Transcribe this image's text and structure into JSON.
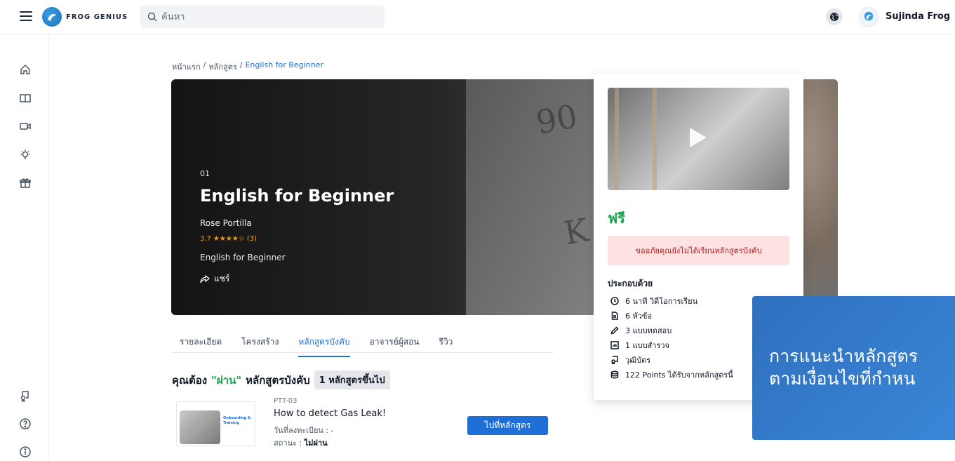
{
  "header": {
    "brand": "FROG GENIUS",
    "search_placeholder": "ค้นหา",
    "username": "Sujinda Frog"
  },
  "breadcrumb": {
    "home": "หน้าแรก",
    "sep1": "/",
    "courses": "หลักสูตร",
    "sep2": "/",
    "current": "English for Beginner"
  },
  "hero": {
    "number": "01",
    "title": "English for Beginner",
    "instructor": "Rose Portilla",
    "rating": "3.7",
    "stars": "★★★★☆",
    "rating_count": "(3)",
    "subtitle": "English for Beginner",
    "share_label": "แชร์"
  },
  "tabs": [
    {
      "label": "รายละเอียด"
    },
    {
      "label": "โครงสร้าง"
    },
    {
      "label": "หลักสูตรบังคับ"
    },
    {
      "label": "อาจารย์ผู้สอน"
    },
    {
      "label": "รีวิว"
    }
  ],
  "requirement": {
    "prefix": "คุณต้อง",
    "pass_word": "\"ผ่าน\"",
    "suffix": "หลักสูตรบังคับ",
    "badge": "1 หลักสูตรขึ้นไป"
  },
  "required_course": {
    "code": "PTT-03",
    "title": "How to detect Gas Leak!",
    "enroll_date": "วันที่ลงทะเบียน : -",
    "status_label": "สถานะ : ",
    "status_value": "ไม่ผ่าน",
    "thumb_label": "Onboarding & Training",
    "button": "ไปที่หลักสูตร"
  },
  "card": {
    "price": "ฟรี",
    "alert": "ขออภัยคุณยังไม่ได้เรียนหลักสูตรบังคับ",
    "includes_title": "ประกอบด้วย",
    "includes": [
      {
        "icon": "clock-icon",
        "text": "6 นาที วิดีโอการเรียน"
      },
      {
        "icon": "file-icon",
        "text": "6 หัวข้อ"
      },
      {
        "icon": "pencil-icon",
        "text": "3 แบบทดสอบ"
      },
      {
        "icon": "chart-icon",
        "text": "1 แบบสำรวจ"
      },
      {
        "icon": "certificate-icon",
        "text": "วุฒิบัตร"
      },
      {
        "icon": "coins-icon",
        "text": "122 Points ได้รับจากหลักสูตรนี้"
      }
    ]
  },
  "promo": {
    "line1": "การแนะนำหลักสูตร",
    "line2": "ตามเงื่อนไขที่กำหน"
  },
  "colors": {
    "accent": "#1d6fd6",
    "pass_green": "#16a34a",
    "alert_bg": "#fde2e4",
    "promo_bg": "#2f6fbf"
  }
}
